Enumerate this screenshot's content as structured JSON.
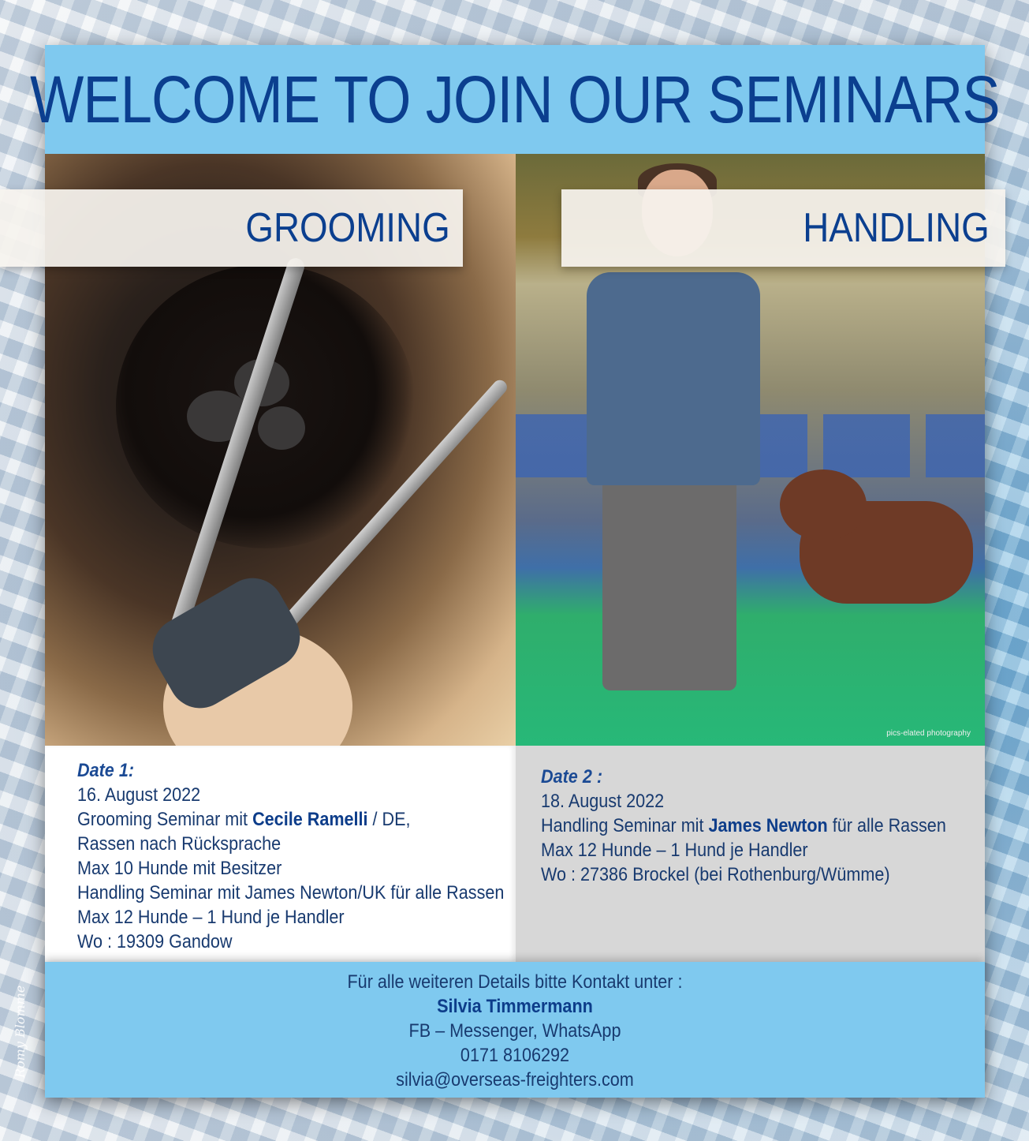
{
  "header": {
    "title": "WELCOME TO JOIN OUR SEMINARS"
  },
  "panels": {
    "left": {
      "tag": "GROOMING"
    },
    "right": {
      "tag": "HANDLING",
      "credit": "pics-elated photography"
    }
  },
  "seminar1": {
    "date_label": "Date 1:",
    "date": "16. August 2022",
    "line1_prefix": "Grooming Seminar mit ",
    "line1_name": "Cecile Ramelli",
    "line1_suffix": " / DE,",
    "line2": "Rassen nach Rücksprache",
    "line3": "Max 10 Hunde mit Besitzer",
    "line4": "Handling Seminar mit James Newton/UK für alle Rassen",
    "line5": "Max 12 Hunde – 1 Hund je Handler",
    "line6": "Wo : 19309 Gandow"
  },
  "seminar2": {
    "date_label": "Date 2 :",
    "date": "18. August 2022",
    "line1_prefix": "Handling Seminar mit ",
    "line1_name": "James Newton",
    "line1_suffix": " für alle Rassen",
    "line2": "Max 12 Hunde – 1 Hund je Handler",
    "line3": "Wo : 27386 Brockel (bei Rothenburg/Wümme)"
  },
  "contact": {
    "intro": "Für alle weiteren Details bitte Kontakt unter :",
    "name": "Silvia Timmermann",
    "channels": "FB – Messenger, WhatsApp",
    "phone": "0171 8106292",
    "email": "silvia@overseas-freighters.com"
  },
  "signature": "Romy Blomme",
  "colors": {
    "accent_blue": "#7fc9ef",
    "title_blue": "#0b3f8f"
  }
}
